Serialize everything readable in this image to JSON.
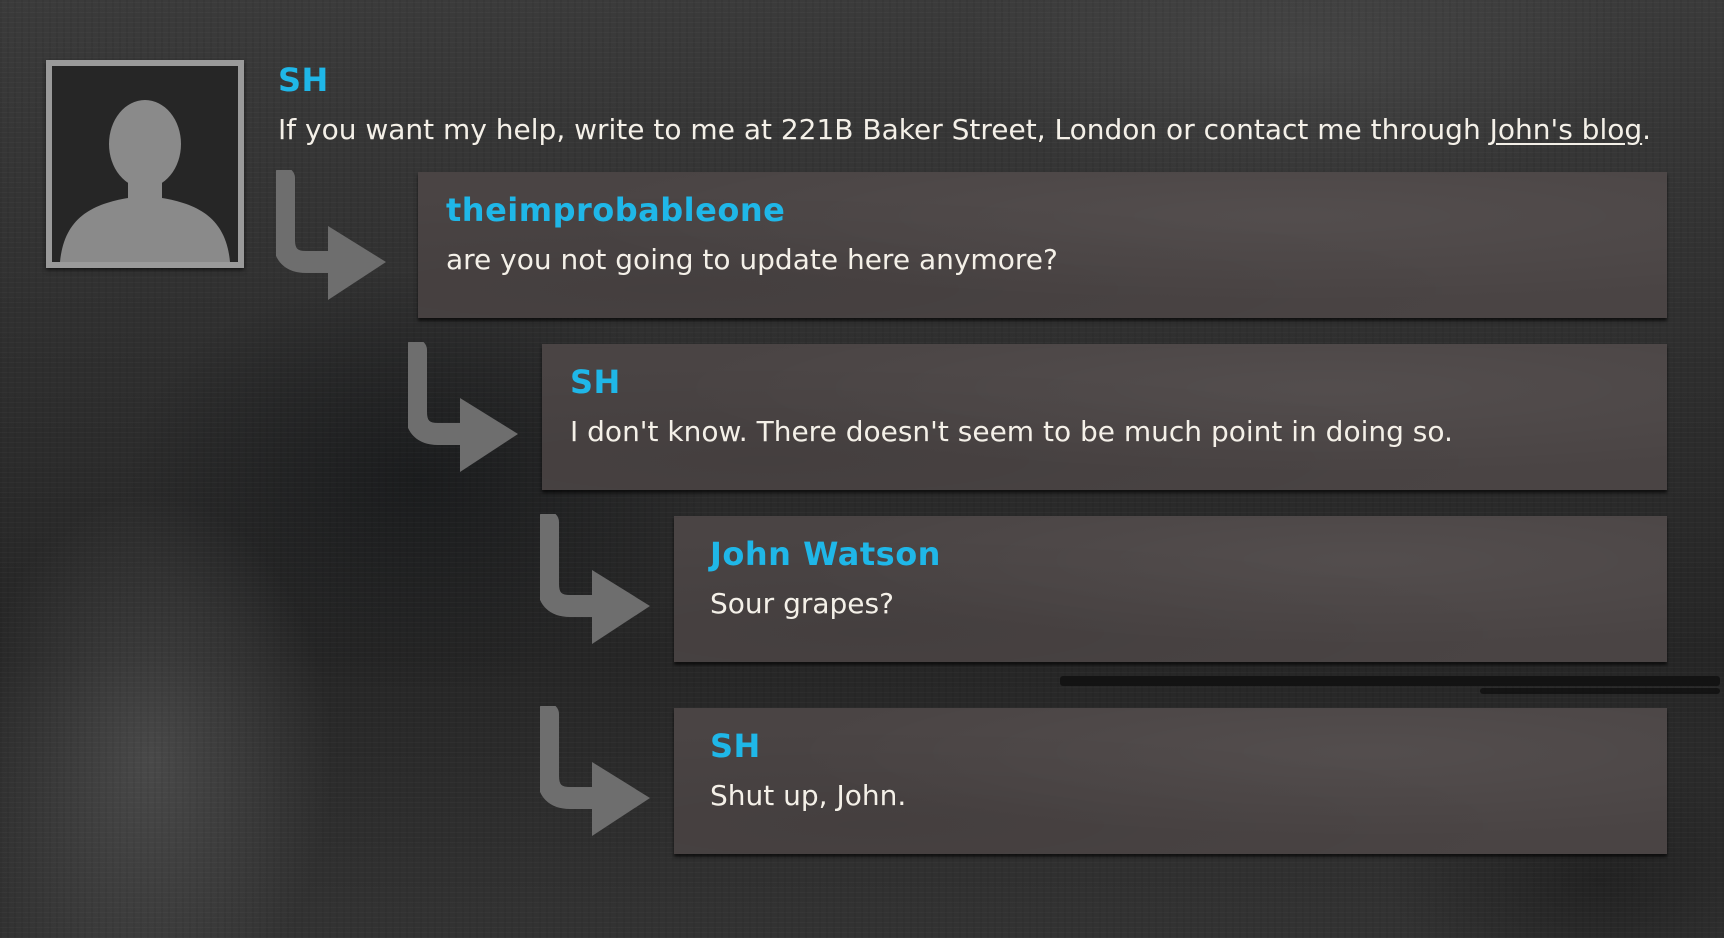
{
  "main_comment": {
    "author": "SH",
    "text_before_link": "If you want my help, write to me at 221B Baker Street, London or contact me through ",
    "link_text": "John's blog",
    "text_after_link": "."
  },
  "replies": [
    {
      "author": "theimprobableone",
      "text": "are you not going to update here anymore?"
    },
    {
      "author": "SH",
      "text": "I don't know. There doesn't seem to be much point in doing so."
    },
    {
      "author": "John Watson",
      "text": "Sour grapes?"
    },
    {
      "author": "SH",
      "text": "Shut up, John."
    }
  ],
  "colors": {
    "author": "#1fb7e8",
    "text": "#f4f0e8",
    "reply_box": "#4a4444",
    "arrow": "#6e6e6e"
  },
  "icons": {
    "avatar": "silhouette-avatar-icon",
    "reply": "reply-arrow-icon"
  }
}
